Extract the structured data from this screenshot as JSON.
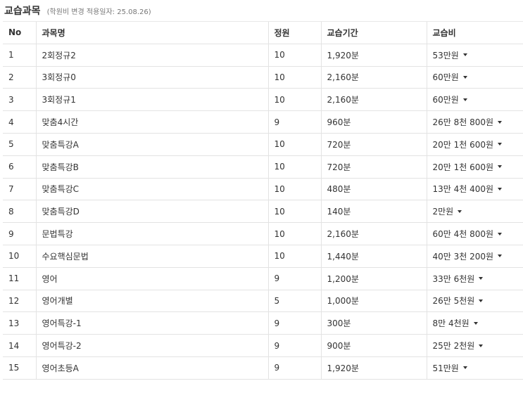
{
  "heading": {
    "title": "교습과목",
    "note": "(학원비 변경 적용일자: 25.08.26)"
  },
  "table": {
    "headers": [
      "No",
      "과목명",
      "정원",
      "교습기간",
      "교습비"
    ],
    "rows": [
      {
        "no": "1",
        "name": "2회정규2",
        "capacity": "10",
        "period": "1,920분",
        "fee": "53만원"
      },
      {
        "no": "2",
        "name": "3회정규0",
        "capacity": "10",
        "period": "2,160분",
        "fee": "60만원"
      },
      {
        "no": "3",
        "name": "3회정규1",
        "capacity": "10",
        "period": "2,160분",
        "fee": "60만원"
      },
      {
        "no": "4",
        "name": "맞춤4시간",
        "capacity": "9",
        "period": "960분",
        "fee": "26만 8천 800원"
      },
      {
        "no": "5",
        "name": "맞춤특강A",
        "capacity": "10",
        "period": "720분",
        "fee": "20만 1천 600원"
      },
      {
        "no": "6",
        "name": "맞춤특강B",
        "capacity": "10",
        "period": "720분",
        "fee": "20만 1천 600원"
      },
      {
        "no": "7",
        "name": "맞춤특강C",
        "capacity": "10",
        "period": "480분",
        "fee": "13만 4천 400원"
      },
      {
        "no": "8",
        "name": "맞춤특강D",
        "capacity": "10",
        "period": "140분",
        "fee": "2만원"
      },
      {
        "no": "9",
        "name": "문법특강",
        "capacity": "10",
        "period": "2,160분",
        "fee": "60만 4천 800원"
      },
      {
        "no": "10",
        "name": "수요핵심문법",
        "capacity": "10",
        "period": "1,440분",
        "fee": "40만 3천 200원"
      },
      {
        "no": "11",
        "name": "영어",
        "capacity": "9",
        "period": "1,200분",
        "fee": "33만 6천원"
      },
      {
        "no": "12",
        "name": "영어개별",
        "capacity": "5",
        "period": "1,000분",
        "fee": "26만 5천원"
      },
      {
        "no": "13",
        "name": "영어특강-1",
        "capacity": "9",
        "period": "300분",
        "fee": "8만 4천원"
      },
      {
        "no": "14",
        "name": "영어특강-2",
        "capacity": "9",
        "period": "900분",
        "fee": "25만 2천원"
      },
      {
        "no": "15",
        "name": "영어초등A",
        "capacity": "9",
        "period": "1,920분",
        "fee": "51만원"
      }
    ]
  },
  "icons": {
    "fee_expand": "caret-down-icon"
  }
}
